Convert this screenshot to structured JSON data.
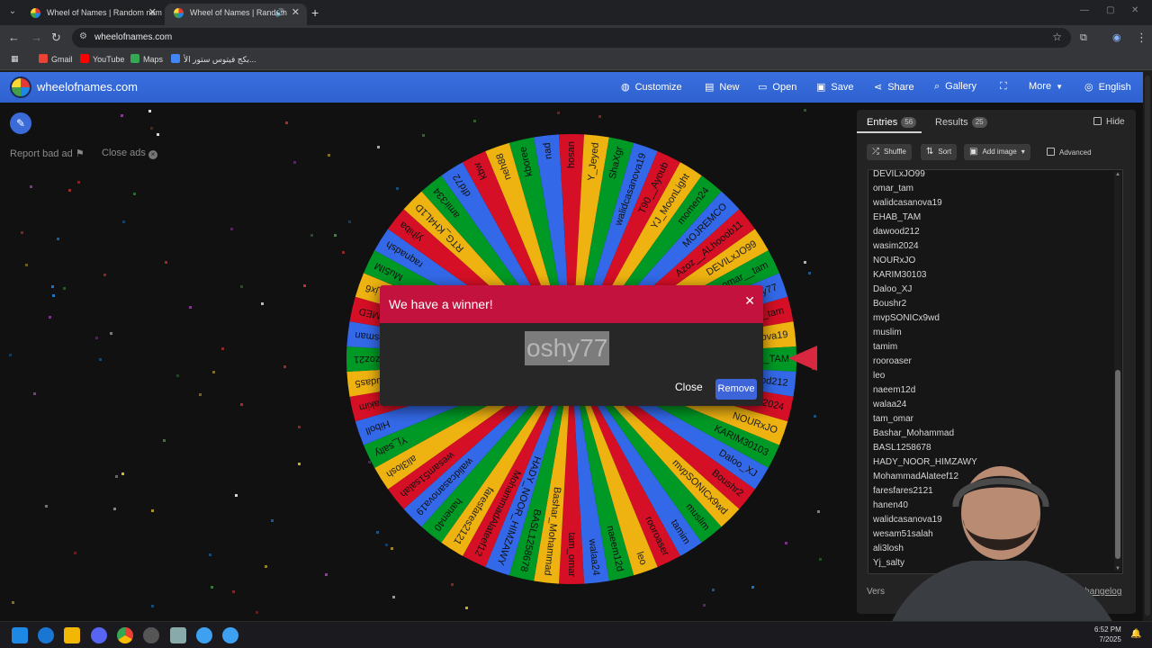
{
  "browser": {
    "tabs": [
      {
        "title": "Wheel of Names | Random nam",
        "active": false
      },
      {
        "title": "Wheel of Names | Random",
        "active": true
      }
    ],
    "url": "wheelofnames.com",
    "bookmarks": [
      {
        "label": "Gmail",
        "color": "#ea4335"
      },
      {
        "label": "YouTube",
        "color": "#ff0000"
      },
      {
        "label": "Maps",
        "color": "#34a853"
      },
      {
        "label": "بكج فيتوس ستور الأ...",
        "color": "#4285f4"
      }
    ]
  },
  "header": {
    "site_name": "wheelofnames.com",
    "buttons": [
      {
        "label": "Customize",
        "icon": "palette-icon"
      },
      {
        "label": "New",
        "icon": "file-icon"
      },
      {
        "label": "Open",
        "icon": "folder-icon"
      },
      {
        "label": "Save",
        "icon": "save-icon"
      },
      {
        "label": "Share",
        "icon": "share-icon"
      },
      {
        "label": "Gallery",
        "icon": "search-icon"
      },
      {
        "label": "",
        "icon": "fullscreen-icon"
      },
      {
        "label": "More",
        "icon": "chevron-down-icon"
      },
      {
        "label": "English",
        "icon": "globe-icon"
      }
    ],
    "color": "#3369e8"
  },
  "left": {
    "report_label": "Report bad ad",
    "close_ads_label": "Close ads"
  },
  "wheel": {
    "colors": [
      "#3369e8",
      "#d50f25",
      "#eeb211",
      "#009925"
    ],
    "segments": [
      "oshy77",
      "omar_tam",
      "walidcasanova19",
      "EHAB_TAM",
      "dawood212",
      "wasim2024",
      "NOURxJO",
      "KARIM30103",
      "Daloo_XJ",
      "Boushr2",
      "mvpSONICx9wd",
      "muslim",
      "tamim",
      "rooroaser",
      "leo",
      "naeem12d",
      "walaa24",
      "tam_omar",
      "Bashar_Mohammad",
      "BASL1258678",
      "HADY_NOOR_HIMZAWY",
      "MohammadAlateef12",
      "faresfares2121",
      "hanen40",
      "walidcasanova19",
      "wesam51salah",
      "ali3losh",
      "Yj_salty",
      "Hiboll",
      "Leaderhakim",
      "Abuhudas5",
      "Izoz21",
      "mohammedosman",
      "YJ_MOHAMMED",
      "xx_jx6",
      "Mu5IM",
      "raqnadsh",
      "yjhiba",
      "RTG_KH4L1D",
      "amir334",
      "dfd72",
      "kbw",
      "neh88",
      "kboree",
      "nad",
      "hosan",
      "Y_Jeyed",
      "ShaXgr",
      "walidcasanova19",
      "T90__Ayoub",
      "YJ_MoonLight",
      "momen24",
      "MOJREMCO",
      "Azoz__ALhooob11",
      "DEVILxJO99",
      "omar__tam"
    ]
  },
  "dialog": {
    "title": "We have a winner!",
    "winner": "oshy77",
    "close_label": "Close",
    "remove_label": "Remove",
    "header_color": "#c4123e"
  },
  "panel": {
    "entries_tab": {
      "label": "Entries",
      "count": "56"
    },
    "results_tab": {
      "label": "Results",
      "count": "25"
    },
    "hide_label": "Hide",
    "shuffle_label": "Shuffle",
    "sort_label": "Sort",
    "add_image_label": "Add image",
    "advanced_label": "Advanced",
    "entries": [
      "DEVILxJO99",
      "omar_tam",
      "walidcasanova19",
      "EHAB_TAM",
      "dawood212",
      "wasim2024",
      "NOURxJO",
      "KARIM30103",
      "Daloo_XJ",
      "Boushr2",
      "mvpSONICx9wd",
      "muslim",
      "tamim",
      "rooroaser",
      "leo",
      "naeem12d",
      "walaa24",
      "tam_omar",
      "Bashar_Mohammad",
      "BASL1258678",
      "HADY_NOOR_HIMZAWY",
      "MohammadAlateef12",
      "faresfares2121",
      "hanen40",
      "walidcasanova19",
      "wesam51salah",
      "ali3losh",
      "Yj_salty"
    ],
    "version_label": "Vers",
    "changelog_label": "Changelog"
  },
  "taskbar": {
    "time": "6:52 PM",
    "date": "7/2025"
  }
}
